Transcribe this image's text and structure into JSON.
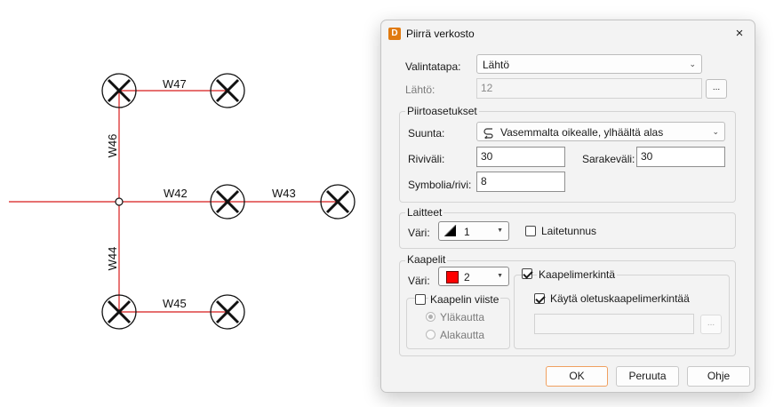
{
  "canvas": {
    "cable_labels": [
      "W47",
      "W46",
      "W42",
      "W43",
      "W44",
      "W45"
    ],
    "line_color": "#d81b1b"
  },
  "dialog": {
    "app_icon": "D",
    "title": "Piirrä verkosto",
    "close_icon": "×",
    "selection": {
      "label": "Valintatapa:",
      "value": "Lähtö"
    },
    "source": {
      "label": "Lähtö:",
      "value": "12",
      "browse": "..."
    },
    "drawing": {
      "title": "Piirtoasetukset",
      "direction_label": "Suunta:",
      "direction_value": "Vasemmalta oikealle, ylhäältä alas",
      "row_spacing_label": "Riviväli:",
      "row_spacing_value": "30",
      "col_spacing_label": "Sarakeväli:",
      "col_spacing_value": "30",
      "symbols_label": "Symbolia/rivi:",
      "symbols_value": "8"
    },
    "devices": {
      "title": "Laitteet",
      "color_label": "Väri:",
      "color_value": "1",
      "device_id_label": "Laitetunnus",
      "device_id_checked": false
    },
    "cables": {
      "title": "Kaapelit",
      "color_label": "Väri:",
      "color_value": "2",
      "color_swatch": "#ff0000",
      "bevel_label": "Kaapelin viiste",
      "bevel_checked": false,
      "over_label": "Yläkautta",
      "under_label": "Alakautta",
      "marking_label": "Kaapelimerkintä",
      "marking_checked": true,
      "default_marking_label": "Käytä oletuskaapelimerkintää",
      "default_marking_checked": true,
      "marking_browse": "..."
    },
    "buttons": {
      "ok": "OK",
      "cancel": "Peruuta",
      "help": "Ohje"
    }
  }
}
